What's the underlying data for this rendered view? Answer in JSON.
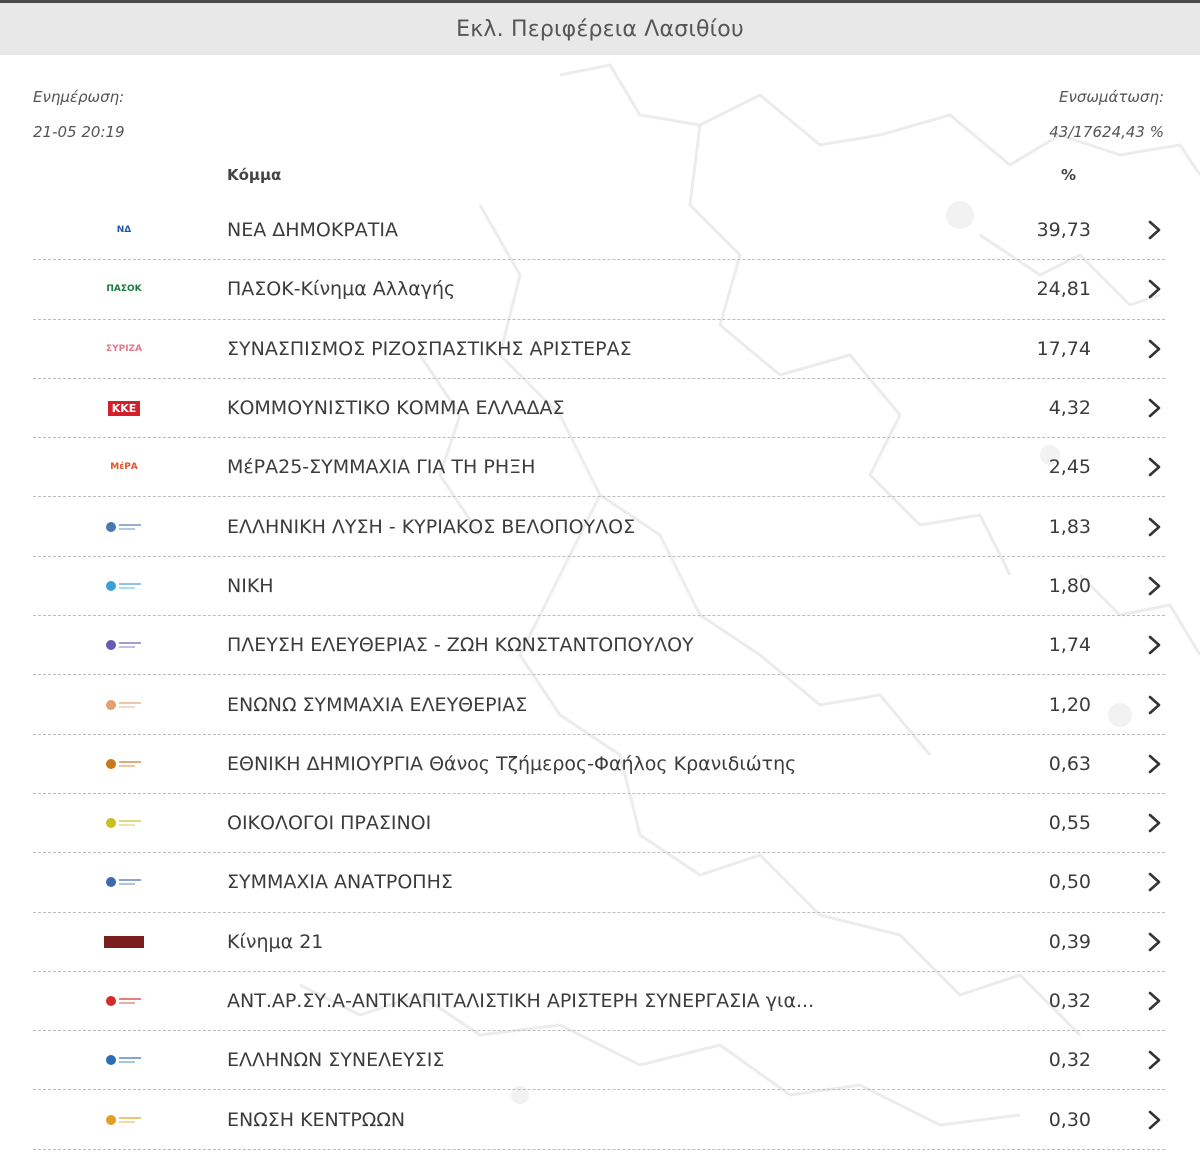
{
  "header": {
    "title": "Εκλ. Περιφέρεια Λασιθίου"
  },
  "update": {
    "label": "Ενημέρωση:",
    "value": "21-05 20:19"
  },
  "incorporation": {
    "label": "Ενσωμάτωση:",
    "count": "43/176",
    "percent": "24,43 %"
  },
  "table": {
    "col_party": "Κόμμα",
    "col_percent": "%",
    "rows": [
      {
        "party": "ΝΕΑ ΔΗΜΟΚΡΑΤΙΑ",
        "percent": "39,73",
        "logo": "nd-logo",
        "logo_text": "ΝΔ",
        "color": "#1e5aa8"
      },
      {
        "party": "ΠΑΣΟΚ-Κίνημα Αλλαγής",
        "percent": "24,81",
        "logo": "pasok-logo",
        "logo_text": "ΠΑΣΟΚ",
        "color": "#1a7a3c"
      },
      {
        "party": "ΣΥΝΑΣΠΙΣΜΟΣ ΡΙΖΟΣΠΑΣΤΙΚΗΣ ΑΡΙΣΤΕΡΑΣ",
        "percent": "17,74",
        "logo": "syriza-logo",
        "logo_text": "ΣΥΡΙΖΑ",
        "color": "#e07a8a"
      },
      {
        "party": "ΚΟΜΜΟΥΝΙΣΤΙΚΟ ΚΟΜΜΑ ΕΛΛΑΔΑΣ",
        "percent": "4,32",
        "logo": "kke-logo",
        "logo_text": "ΚΚΕ",
        "color": "#d4202a"
      },
      {
        "party": "ΜέΡΑ25-ΣΥΜΜΑΧΙΑ ΓΙΑ ΤΗ ΡΗΞΗ",
        "percent": "2,45",
        "logo": "mera25-logo",
        "logo_text": "ΜέΡΑ",
        "color": "#e2522a"
      },
      {
        "party": "ΕΛΛΗΝΙΚΗ ΛΥΣΗ - ΚΥΡΙΑΚΟΣ ΒΕΛΟΠΟΥΛΟΣ",
        "percent": "1,83",
        "logo": "elliniki-lysi-logo",
        "logo_text": "",
        "color": "#4a78b0"
      },
      {
        "party": "ΝΙΚΗ",
        "percent": "1,80",
        "logo": "niki-logo",
        "logo_text": "",
        "color": "#3aa0d8"
      },
      {
        "party": "ΠΛΕΥΣΗ ΕΛΕΥΘΕΡΙΑΣ - ΖΩΗ ΚΩΝΣΤΑΝΤΟΠΟΥΛΟΥ",
        "percent": "1,74",
        "logo": "plefsi-logo",
        "logo_text": "",
        "color": "#6a5ab5"
      },
      {
        "party": "ΕΝΩΝΩ ΣΥΜΜΑΧΙΑ ΕΛΕΥΘΕΡΙΑΣ",
        "percent": "1,20",
        "logo": "enono-logo",
        "logo_text": "",
        "color": "#e5a070"
      },
      {
        "party": "ΕΘΝΙΚΗ ΔΗΜΙΟΥΡΓΙΑ Θάνος Τζήμερος-Φαήλος Κρανιδιώτης",
        "percent": "0,63",
        "logo": "ethniki-dimiourgia-logo",
        "logo_text": "",
        "color": "#c9781c"
      },
      {
        "party": "ΟΙΚΟΛΟΓΟΙ ΠΡΑΣΙΝΟΙ",
        "percent": "0,55",
        "logo": "oikologoi-logo",
        "logo_text": "",
        "color": "#c8c020"
      },
      {
        "party": "ΣΥΜΜΑΧΙΑ ΑΝΑΤΡΟΠΗΣ",
        "percent": "0,50",
        "logo": "anatropi-logo",
        "logo_text": "",
        "color": "#3a6ab0"
      },
      {
        "party": "Κίνημα 21",
        "percent": "0,39",
        "logo": "kinima21-logo",
        "logo_text": "",
        "color": "#7a1e1e"
      },
      {
        "party": "ΑΝΤ.ΑΡ.ΣΥ.Α-ΑΝΤΙΚΑΠΙΤΑΛΙΣΤΙΚΗ ΑΡΙΣΤΕΡΗ ΣΥΝΕΡΓΑΣΙΑ για...",
        "percent": "0,32",
        "logo": "antarsya-logo",
        "logo_text": "",
        "color": "#d42a2a"
      },
      {
        "party": "ΕΛΛΗΝΩΝ ΣΥΝΕΛΕΥΣΙΣ",
        "percent": "0,32",
        "logo": "ellinon-synelefsis-logo",
        "logo_text": "",
        "color": "#2e6db0"
      },
      {
        "party": "ΕΝΩΣΗ ΚΕΝΤΡΩΩΝ",
        "percent": "0,30",
        "logo": "enosi-kentroon-logo",
        "logo_text": "",
        "color": "#e0a020"
      }
    ]
  },
  "colors": {
    "header_bg": "#e8e8e8",
    "topline": "#4a4a4a",
    "row_divider": "#bdbdbd",
    "text": "#3c3c3c"
  }
}
